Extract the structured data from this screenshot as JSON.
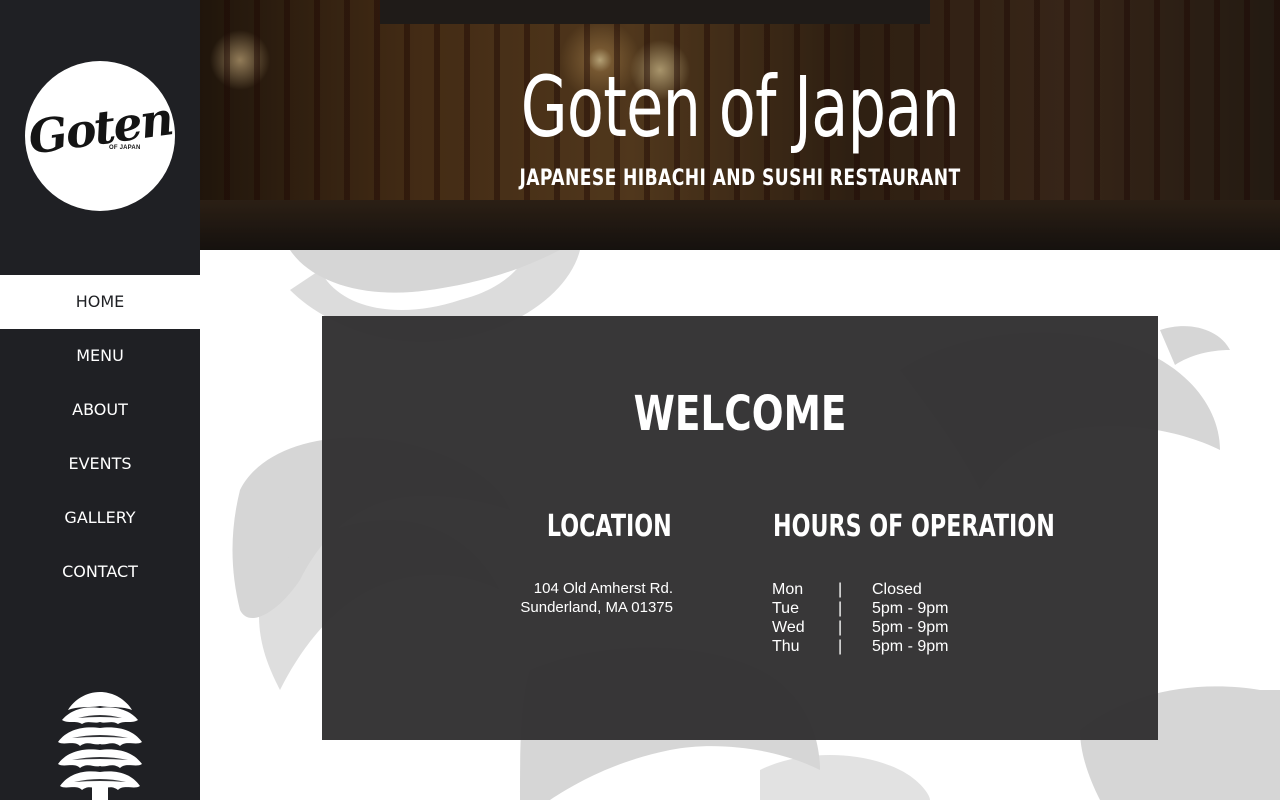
{
  "sidebar": {
    "logo": {
      "script_text": "Goten",
      "sub_text": "OF JAPAN"
    },
    "nav": [
      {
        "label": "HOME",
        "active": true
      },
      {
        "label": "MENU",
        "active": false
      },
      {
        "label": "ABOUT",
        "active": false
      },
      {
        "label": "EVENTS",
        "active": false
      },
      {
        "label": "GALLERY",
        "active": false
      },
      {
        "label": "CONTACT",
        "active": false
      }
    ],
    "bottom_icon": "pine-tree-icon"
  },
  "hero": {
    "title": "Goten of Japan",
    "subtitle": "JAPANESE HIBACHI AND SUSHI RESTAURANT"
  },
  "welcome": {
    "heading": "WELCOME",
    "location": {
      "heading": "LOCATION",
      "address_line1": "104 Old Amherst Rd.",
      "address_line2": "Sunderland, MA 01375"
    },
    "hours": {
      "heading": "HOURS OF OPERATION",
      "separator": "|",
      "rows": [
        {
          "day": "Mon",
          "time": "Closed"
        },
        {
          "day": "Tue",
          "time": "5pm - 9pm"
        },
        {
          "day": "Wed",
          "time": "5pm - 9pm"
        },
        {
          "day": "Thu",
          "time": "5pm - 9pm"
        }
      ]
    }
  },
  "colors": {
    "sidebar_bg": "#1f2024",
    "panel_bg": "#302f30",
    "text_light": "#ffffff",
    "watermark": "#d6d6d6"
  }
}
